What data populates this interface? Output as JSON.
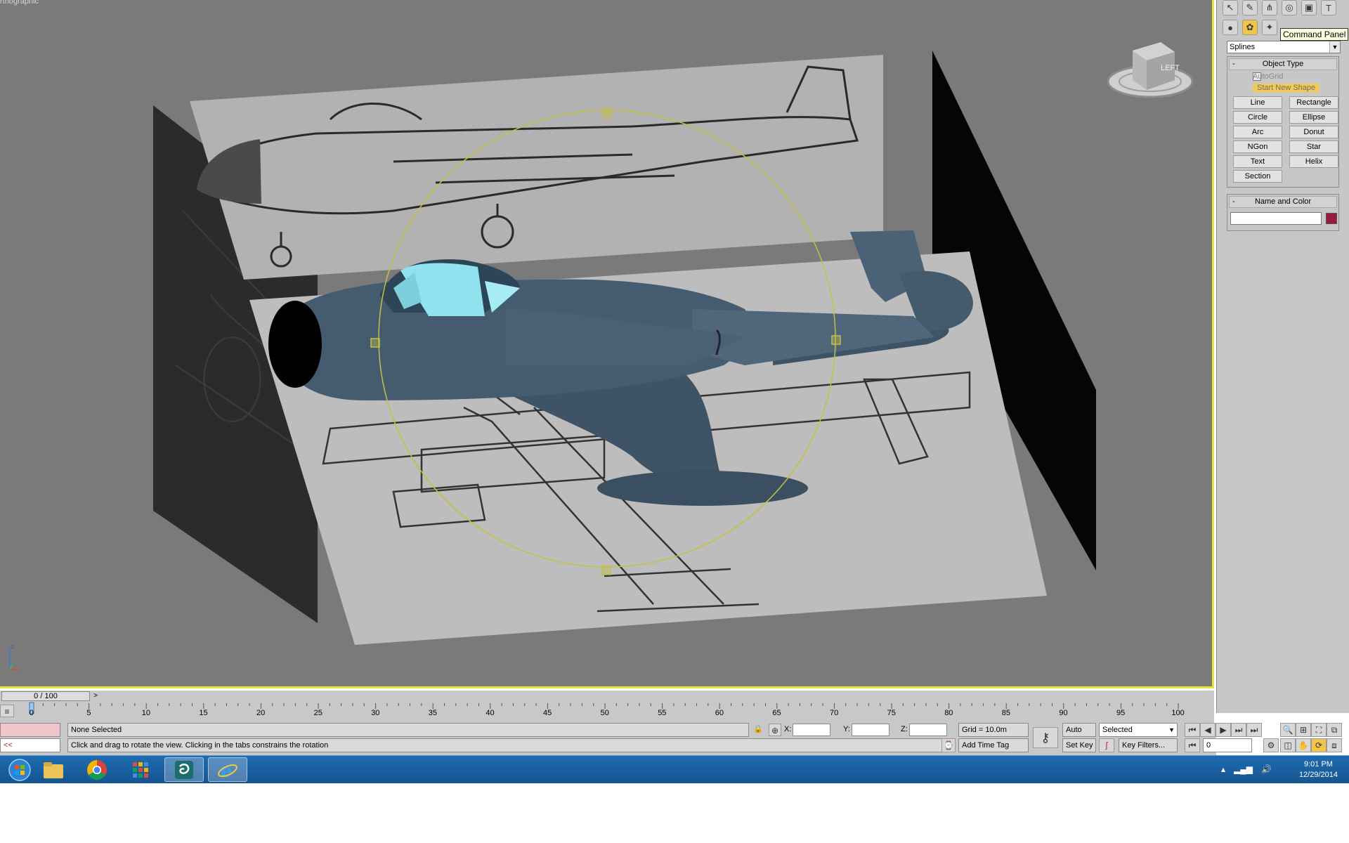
{
  "viewport": {
    "label": "rthographic"
  },
  "viewcube": {
    "face_label": "LEFT"
  },
  "axis": {
    "z_label": "z"
  },
  "command_panel": {
    "tooltip": "Command Panel",
    "category_dropdown": "Splines",
    "object_type": {
      "title": "Object Type",
      "autogrid_label": "AutoGrid",
      "start_new_shape_label": "Start New Shape",
      "start_new_shape_checked": true,
      "buttons": [
        "Line",
        "Rectangle",
        "Circle",
        "Ellipse",
        "Arc",
        "Donut",
        "NGon",
        "Star",
        "Text",
        "Helix",
        "Section"
      ]
    },
    "name_and_color": {
      "title": "Name and Color",
      "name_value": "",
      "color": "#9c1840"
    }
  },
  "time_slider": {
    "frame": "0 / 100",
    "next": ">"
  },
  "trackbar": {
    "ticks": [
      0,
      5,
      10,
      15,
      20,
      25,
      30,
      35,
      40,
      45,
      50,
      55,
      60,
      65,
      70,
      75,
      80,
      85,
      90,
      95,
      100
    ]
  },
  "status": {
    "selection": "None Selected",
    "prompt": "Click and drag to rotate the view.  Clicking in the tabs constrains the rotation",
    "maxscript_arrow": "<<",
    "x_label": "X:",
    "y_label": "Y:",
    "z_label": "Z:",
    "grid": "Grid = 10.0m",
    "add_time_tag": "Add Time Tag",
    "auto_key": "Auto Key",
    "set_key": "Set Key",
    "selected_dropdown": "Selected",
    "key_filters": "Key Filters...",
    "frame_field": "0"
  },
  "taskbar": {
    "time": "9:01 PM",
    "date": "12/29/2014",
    "apps": [
      "start-button",
      "file-explorer",
      "chrome",
      "apps-grid",
      "3ds-max",
      "internet-explorer"
    ]
  }
}
